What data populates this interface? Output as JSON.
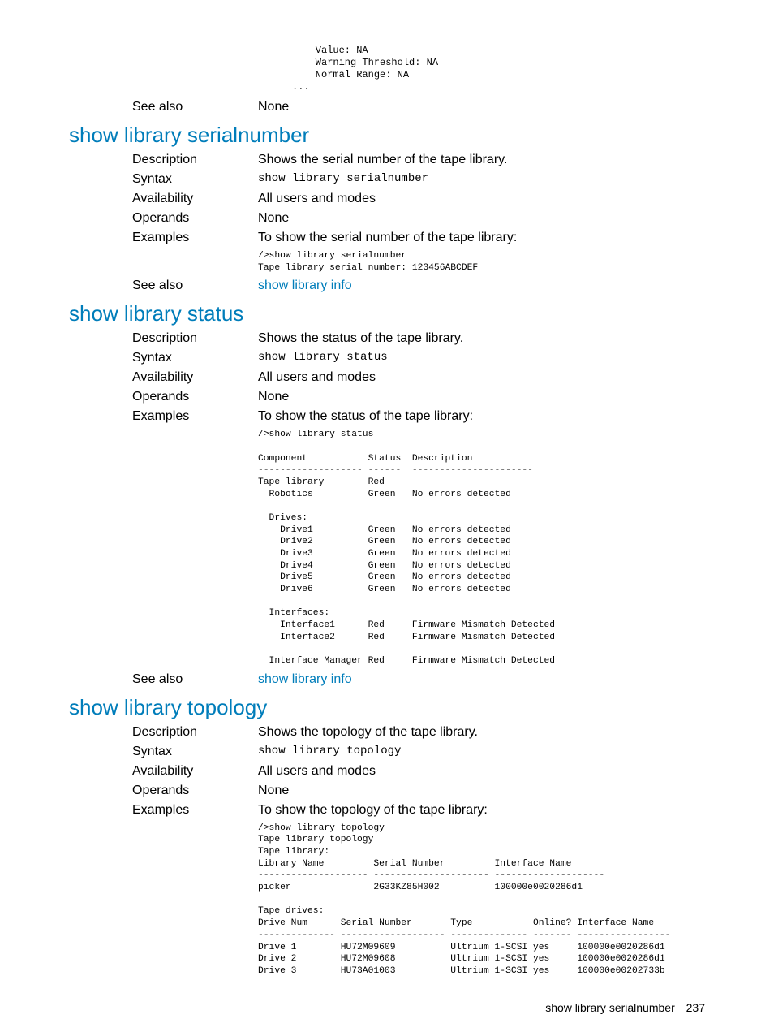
{
  "pre_top": "    Value: NA\n    Warning Threshold: NA\n    Normal Range: NA\n...",
  "row_see_also_top": {
    "label": "See also",
    "value": "None"
  },
  "sections": {
    "serialnumber": {
      "title": "show library serialnumber",
      "rows": {
        "description": {
          "label": "Description",
          "value": "Shows the serial number of the tape library."
        },
        "syntax": {
          "label": "Syntax",
          "value": "show library serialnumber"
        },
        "availability": {
          "label": "Availability",
          "value": "All users and modes"
        },
        "operands": {
          "label": "Operands",
          "value": "None"
        },
        "examples": {
          "label": "Examples",
          "value": "To show the serial number of the tape library:"
        },
        "see_also": {
          "label": "See also",
          "value": "show library info"
        }
      },
      "example_block": "/>show library serialnumber\nTape library serial number: 123456ABCDEF"
    },
    "status": {
      "title": "show library status",
      "rows": {
        "description": {
          "label": "Description",
          "value": "Shows the status of the tape library."
        },
        "syntax": {
          "label": "Syntax",
          "value": "show library status"
        },
        "availability": {
          "label": "Availability",
          "value": "All users and modes"
        },
        "operands": {
          "label": "Operands",
          "value": "None"
        },
        "examples": {
          "label": "Examples",
          "value": "To show the status of the tape library:"
        },
        "see_also": {
          "label": "See also",
          "value": "show library info"
        }
      },
      "example_block": "/>show library status\n\nComponent           Status  Description\n------------------- ------  ----------------------\nTape library        Red\n  Robotics          Green   No errors detected\n\n  Drives:\n    Drive1          Green   No errors detected\n    Drive2          Green   No errors detected\n    Drive3          Green   No errors detected\n    Drive4          Green   No errors detected\n    Drive5          Green   No errors detected\n    Drive6          Green   No errors detected\n\n  Interfaces:\n    Interface1      Red     Firmware Mismatch Detected\n    Interface2      Red     Firmware Mismatch Detected\n\n  Interface Manager Red     Firmware Mismatch Detected"
    },
    "topology": {
      "title": "show library topology",
      "rows": {
        "description": {
          "label": "Description",
          "value": "Shows the topology of the tape library."
        },
        "syntax": {
          "label": "Syntax",
          "value": "show library topology"
        },
        "availability": {
          "label": "Availability",
          "value": "All users and modes"
        },
        "operands": {
          "label": "Operands",
          "value": "None"
        },
        "examples": {
          "label": "Examples",
          "value": "To show the topology of the tape library:"
        }
      },
      "example_block": "/>show library topology\nTape library topology\nTape library:\nLibrary Name         Serial Number         Interface Name\n-------------------- --------------------- --------------------\npicker               2G33KZ85H002          100000e0020286d1\n\nTape drives:\nDrive Num      Serial Number       Type           Online? Interface Name\n-------------- ------------------- -------------- ------- -----------------\nDrive 1        HU72M09609          Ultrium 1-SCSI yes     100000e0020286d1\nDrive 2        HU72M09608          Ultrium 1-SCSI yes     100000e0020286d1\nDrive 3        HU73A01003          Ultrium 1-SCSI yes     100000e00202733b"
    }
  },
  "footer": {
    "text": "show library serialnumber",
    "page": "237"
  }
}
